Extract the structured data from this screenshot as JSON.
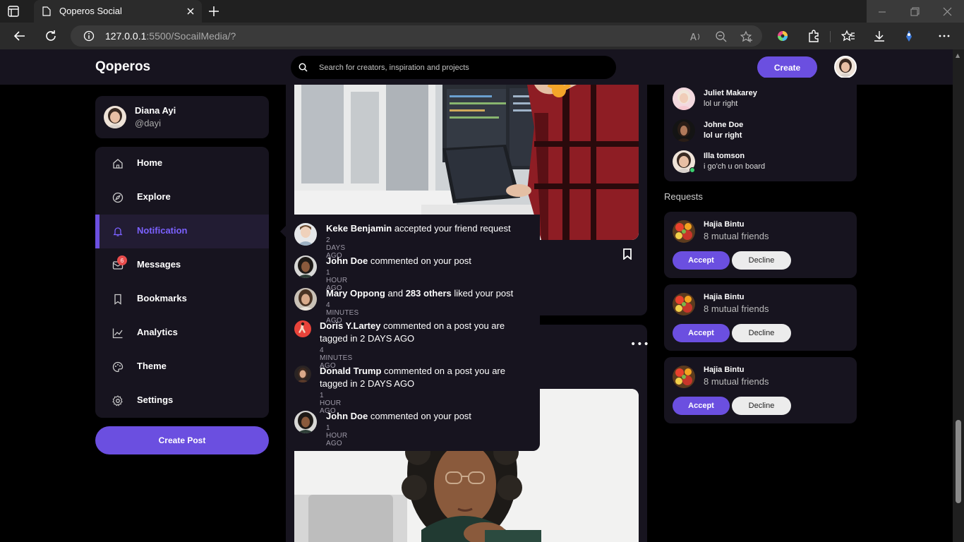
{
  "browser": {
    "tab_title": "Qoperos Social",
    "url_host": "127.0.0.1",
    "url_rest": ":5500/SocailMedia/?"
  },
  "header": {
    "logo": "Qoperos",
    "search_placeholder": "Search for creators, inspiration and projects",
    "create_label": "Create"
  },
  "profile": {
    "name": "Diana Ayi",
    "handle": "@dayi"
  },
  "sidebar": {
    "items": [
      {
        "label": "Home",
        "icon": "home-icon"
      },
      {
        "label": "Explore",
        "icon": "compass-icon"
      },
      {
        "label": "Notification",
        "icon": "bell-icon",
        "active": true
      },
      {
        "label": "Messages",
        "icon": "message-icon",
        "badge": "6"
      },
      {
        "label": "Bookmarks",
        "icon": "bookmark-icon"
      },
      {
        "label": "Analytics",
        "icon": "chart-icon"
      },
      {
        "label": "Theme",
        "icon": "palette-icon"
      },
      {
        "label": "Settings",
        "icon": "gear-icon"
      }
    ],
    "create_post": "Create Post"
  },
  "notifications": [
    {
      "name": "Keke Benjamin",
      "text": " accepted your friend request",
      "time": "2 DAYS AGO"
    },
    {
      "name": "John Doe",
      "text": " commented on your post",
      "time": "1 HOUR AGO"
    },
    {
      "name": "Mary Oppong",
      "text_mid": " and ",
      "name2": "283 others",
      "text": " liked your post",
      "time": "4 MINUTES AGO"
    },
    {
      "name": "Doris Y.Lartey",
      "text": " commented on a post you are",
      "line2": "tagged in 2 DAYS AGO",
      "time": "4 MINUTES AGO"
    },
    {
      "name": "Donald Trump",
      "text": " commented on a post you are",
      "line2": "tagged in 2 DAYS AGO",
      "time": "1 HOUR AGO"
    },
    {
      "name": "John Doe",
      "text": " commented on your post",
      "time": "1 HOUR AGO"
    }
  ],
  "messages": [
    {
      "name": "Juliet Makarey",
      "text": "lol ur right"
    },
    {
      "name": "Johne Doe",
      "text": "lol ur right"
    },
    {
      "name": "Illa tomson",
      "text": "i go'ch u on board"
    }
  ],
  "requests": {
    "heading": "Requests",
    "items": [
      {
        "name": "Hajia Bintu",
        "mutual": "8 mutual friends",
        "accept": "Accept",
        "decline": "Decline"
      },
      {
        "name": "Hajia Bintu",
        "mutual": "8 mutual friends",
        "accept": "Accept",
        "decline": "Decline"
      },
      {
        "name": "Hajia Bintu",
        "mutual": "8 mutual friends",
        "accept": "Accept",
        "decline": "Decline"
      }
    ]
  },
  "colors": {
    "accent": "#6b4fe0",
    "card": "#17141f",
    "background": "#000000"
  }
}
